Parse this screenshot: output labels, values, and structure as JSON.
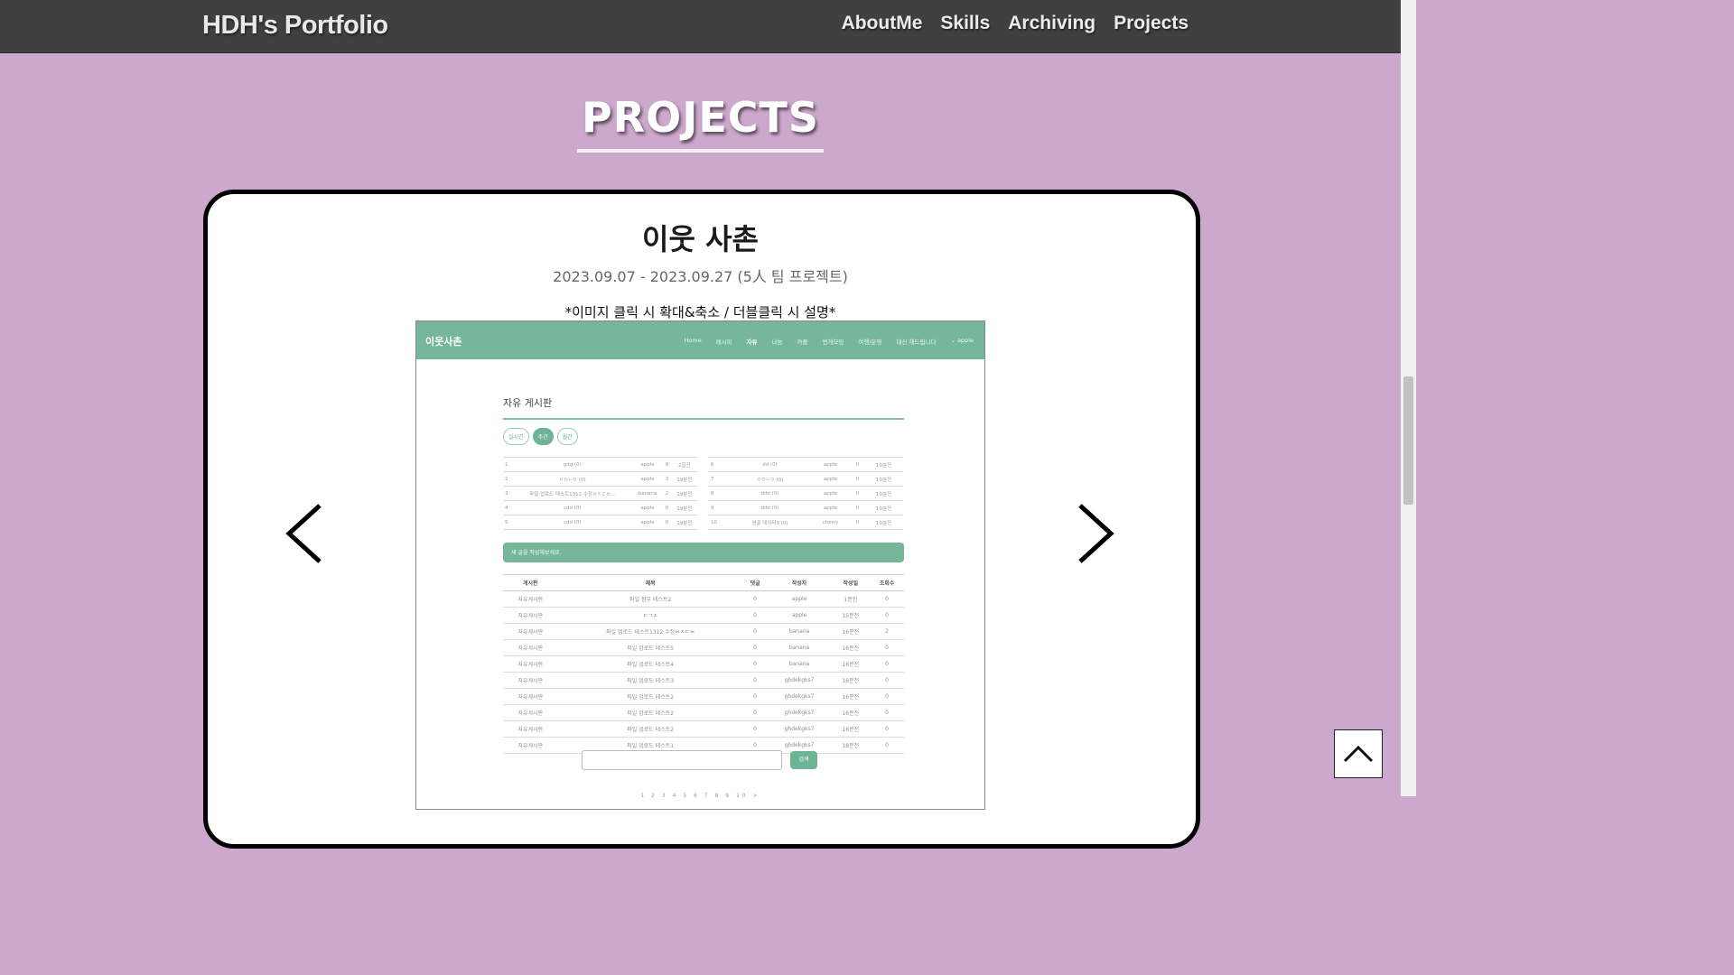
{
  "navbar": {
    "brand": "HDH's Portfolio",
    "items": [
      "AboutMe",
      "Skills",
      "Archiving",
      "Projects"
    ]
  },
  "section": {
    "title": "PROJECTS"
  },
  "project": {
    "name": "이웃 사촌",
    "period": "2023.09.07 - 2023.09.27 (5人 팀 프로젝트)",
    "hint": "*이미지 클릭 시 확대&축소 / 더블클릭 시 설명*"
  },
  "controls": {
    "prev_icon": "chevron-left-icon",
    "next_icon": "chevron-right-icon",
    "top_icon": "chevron-up-icon"
  },
  "screenshot": {
    "brand": "이웃사촌",
    "menu": [
      "Home",
      "레시피",
      "자유",
      "나눔",
      "카풀",
      "번개모임",
      "여행/운영",
      "대신 해드립니다",
      "apple"
    ],
    "active_menu": "자유",
    "board_title": "자유 게시판",
    "pills": [
      "실시간",
      "주간",
      "월간"
    ],
    "active_pill": "주간",
    "rank_left": [
      {
        "no": "1",
        "title": "gdg (0)",
        "user": "apple",
        "views": "9",
        "time": "2일전"
      },
      {
        "no": "2",
        "title": "ㅇㅇㄴㅇ (0)",
        "user": "apple",
        "views": "3",
        "time": "19분전"
      },
      {
        "no": "3",
        "title": "파일 업로드 테스트1312 수정ㅂㅈㄷㅂ... ",
        "user": "banana",
        "views": "2",
        "time": "19분전"
      },
      {
        "no": "4",
        "title": "cdd (0)",
        "user": "apple",
        "views": "0",
        "time": "19분전"
      },
      {
        "no": "5",
        "title": "cdd (0)",
        "user": "apple",
        "views": "0",
        "time": "19분전"
      }
    ],
    "rank_right": [
      {
        "no": "6",
        "title": "dd (0)",
        "user": "apple",
        "views": "0",
        "time": "19분전"
      },
      {
        "no": "7",
        "title": "ㅇㅇㄴㅇ (0)",
        "user": "apple",
        "views": "0",
        "time": "19분전"
      },
      {
        "no": "8",
        "title": "ddd (0)",
        "user": "apple",
        "views": "0",
        "time": "19분전"
      },
      {
        "no": "9",
        "title": "ddd (0)",
        "user": "apple",
        "views": "0",
        "time": "19분전"
      },
      {
        "no": "10",
        "title": "썸골 데이터3 (0)",
        "user": "cherry",
        "views": "0",
        "time": "19분전"
      }
    ],
    "write_prompt": "새 글을 작성해보세요.",
    "columns": [
      "게시판",
      "제목",
      "댓글",
      "작성자",
      "작성일",
      "조회수"
    ],
    "rows": [
      [
        "자유게시판",
        "파일 첨부 테스트2",
        "0",
        "apple",
        "1분전",
        "0"
      ],
      [
        "자유게시판",
        "ㄷㄱㅈ",
        "0",
        "apple",
        "15분전",
        "0"
      ],
      [
        "자유게시판",
        "파일 업로드 테스트1312 수정ㅂㅈㄷㅂ",
        "0",
        "banana",
        "16분전",
        "2"
      ],
      [
        "자유게시판",
        "파일 업로드 테스트5",
        "0",
        "banana",
        "16분전",
        "0"
      ],
      [
        "자유게시판",
        "파일 업로드 테스트4",
        "0",
        "banana",
        "16분전",
        "0"
      ],
      [
        "자유게시판",
        "파일 업로드 테스트3",
        "0",
        "ghdekgks7",
        "16분전",
        "0"
      ],
      [
        "자유게시판",
        "파일 업로드 테스트2",
        "0",
        "ghdekgks7",
        "16분전",
        "0"
      ],
      [
        "자유게시판",
        "파일 업로드 테스트2",
        "0",
        "ghdekgks7",
        "16분전",
        "0"
      ],
      [
        "자유게시판",
        "파일 업로드 테스트2",
        "0",
        "ghdekgks7",
        "16분전",
        "0"
      ],
      [
        "자유게시판",
        "파일 업로드 테스트1",
        "0",
        "ghdekgks7",
        "18분전",
        "0"
      ]
    ],
    "search_button": "검색",
    "pager": "1 2 3 4 5 6 7 8 9 10 >"
  }
}
